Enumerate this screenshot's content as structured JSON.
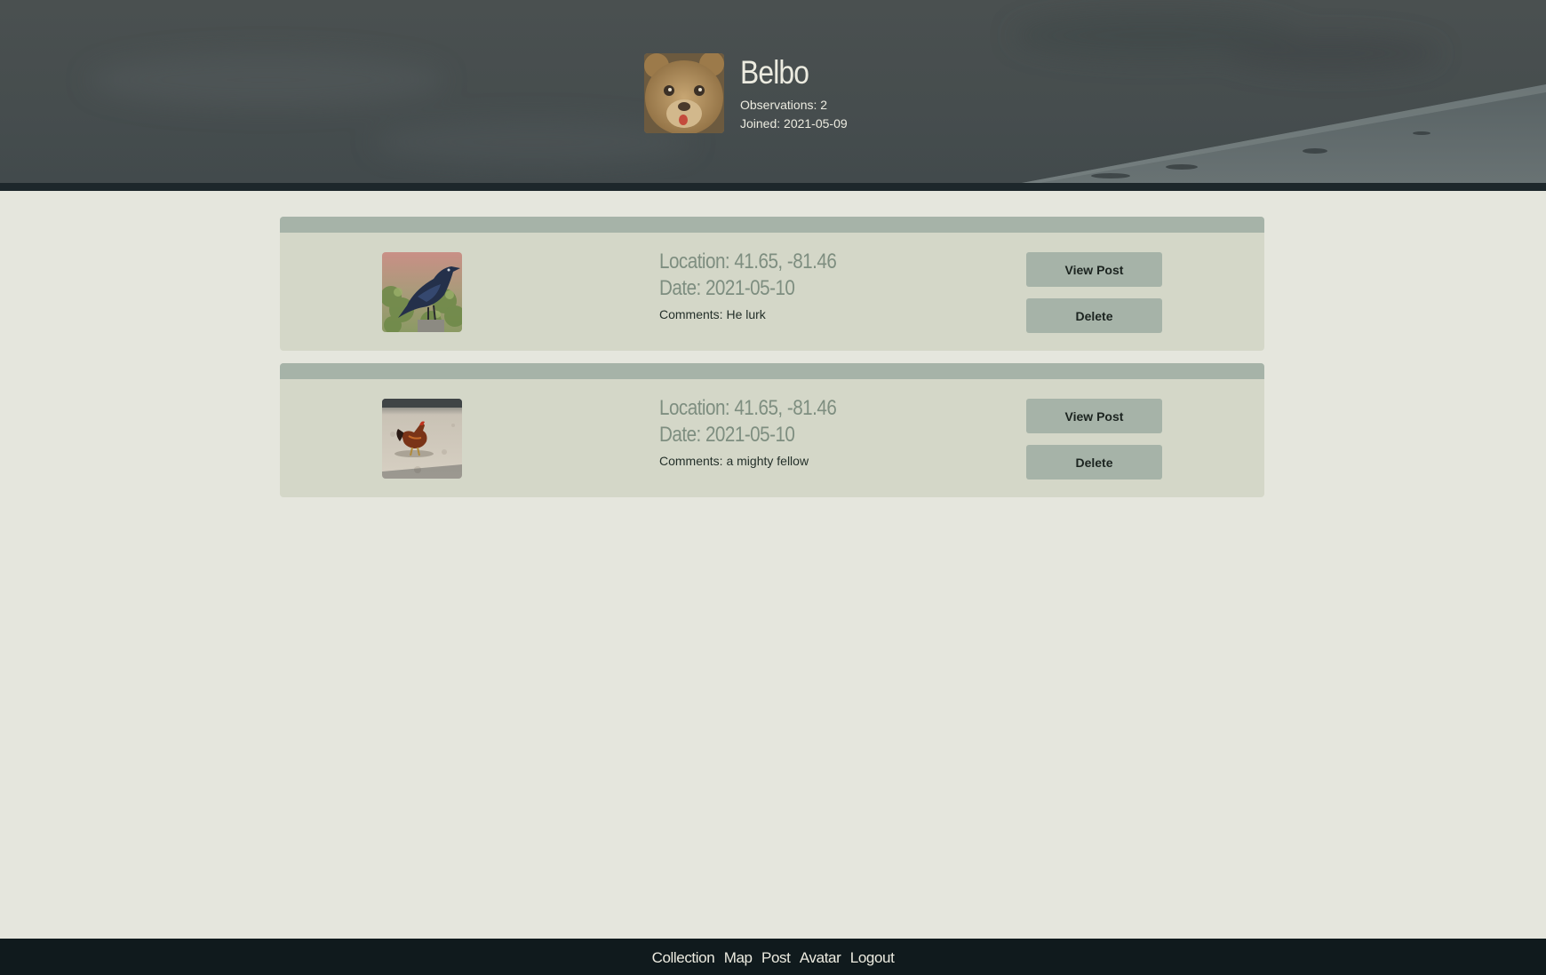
{
  "profile": {
    "name": "Belbo",
    "observations": "Observations: 2",
    "joined": "Joined: 2021-05-09",
    "avatar_icon": "teddy-bear-avatar-icon"
  },
  "observations": [
    {
      "thumbnail_icon": "crow-photo-icon",
      "location": "Location: 41.65, -81.46",
      "date": "Date: 2021-05-10",
      "comments": "Comments: He lurk",
      "view_label": "View Post",
      "delete_label": "Delete"
    },
    {
      "thumbnail_icon": "rooster-photo-icon",
      "location": "Location: 41.65, -81.46",
      "date": "Date: 2021-05-10",
      "comments": "Comments: a mighty fellow",
      "view_label": "View Post",
      "delete_label": "Delete"
    }
  ],
  "footer": {
    "links": [
      "Collection",
      "Map",
      "Post",
      "Avatar",
      "Logout"
    ]
  },
  "colors": {
    "page_bg": "#e5e6dd",
    "banner": "#464d4e",
    "card_bg": "#d4d7c8",
    "card_accent": "#a6b3a8",
    "footer_bg": "#101a1d",
    "info_text": "#7e8e80"
  }
}
